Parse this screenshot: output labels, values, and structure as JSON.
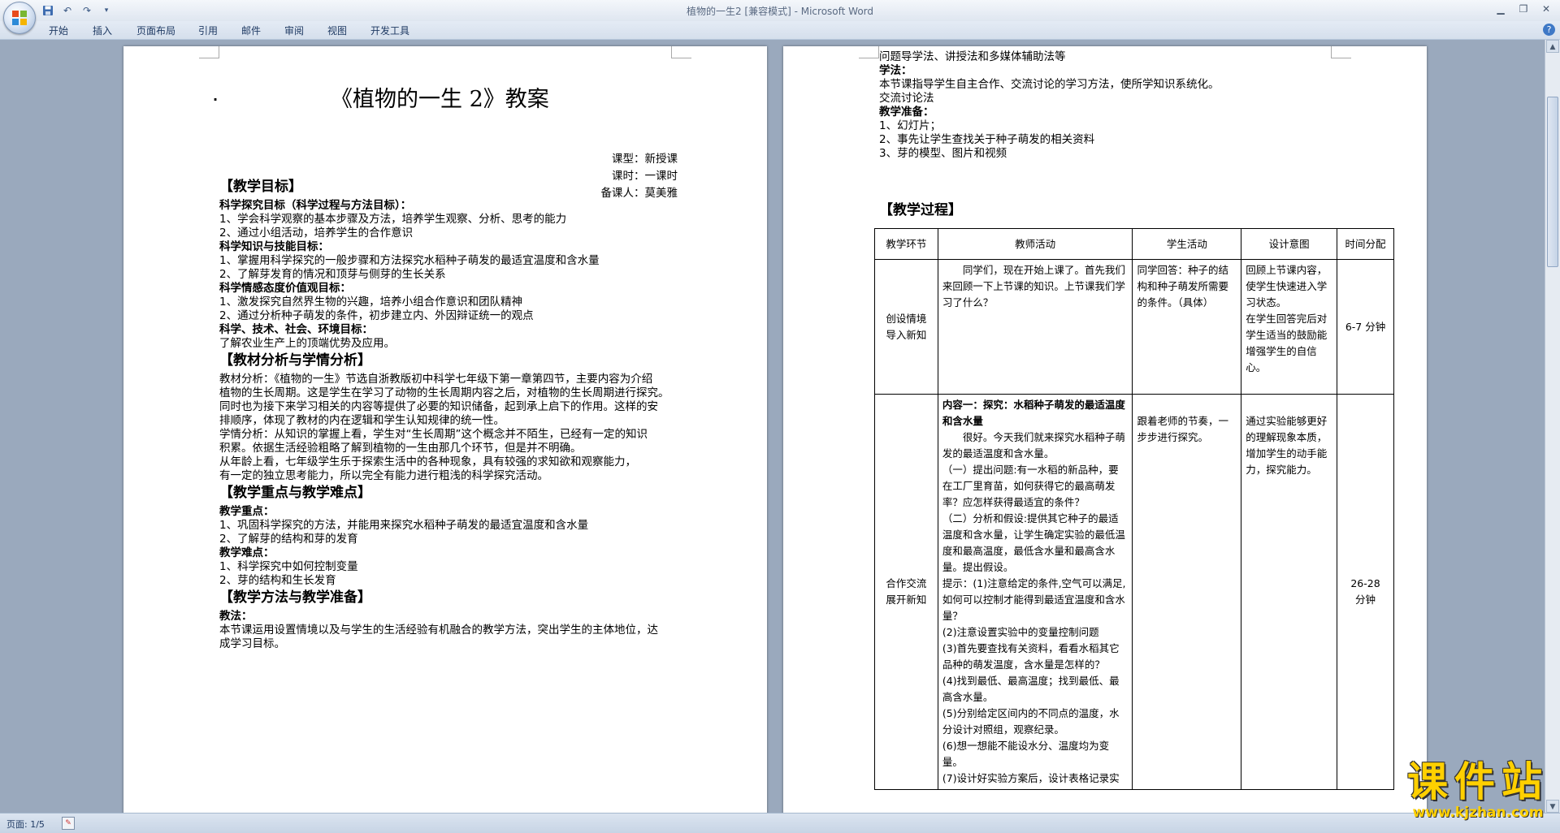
{
  "window": {
    "title": "植物的一生2 [兼容模式] - Microsoft Word",
    "controls": [
      "minimize-icon",
      "restore-icon",
      "close-icon"
    ]
  },
  "ribbon": {
    "tabs": [
      "开始",
      "插入",
      "页面布局",
      "引用",
      "邮件",
      "审阅",
      "视图",
      "开发工具"
    ],
    "help": "?"
  },
  "status": {
    "page": "页面: 1/5"
  },
  "watermark": {
    "text": "课件站",
    "url": "www.kjzhan.com"
  },
  "page1": {
    "dot": "·",
    "title": "《植物的一生 2》教案",
    "meta": [
      "课型：新授课",
      "课时：一课时",
      "备课人：莫美雅"
    ],
    "lines": [
      {
        "cls": "h",
        "text": "【教学目标】"
      },
      {
        "cls": "b",
        "text": "科学探究目标（科学过程与方法目标）："
      },
      {
        "cls": "",
        "text": "1、学会科学观察的基本步骤及方法，培养学生观察、分析、思考的能力"
      },
      {
        "cls": "",
        "text": "2、通过小组活动，培养学生的合作意识"
      },
      {
        "cls": "b",
        "text": "科学知识与技能目标："
      },
      {
        "cls": "",
        "text": "1、掌握用科学探究的一般步骤和方法探究水稻种子萌发的最适宜温度和含水量"
      },
      {
        "cls": "",
        "text": "2、了解芽发育的情况和顶芽与侧芽的生长关系"
      },
      {
        "cls": "b",
        "text": "科学情感态度价值观目标："
      },
      {
        "cls": "",
        "text": "1、激发探究自然界生物的兴趣，培养小组合作意识和团队精神"
      },
      {
        "cls": "",
        "text": "2、通过分析种子萌发的条件，初步建立内、外因辩证统一的观点"
      },
      {
        "cls": "b",
        "text": "科学、技术、社会、环境目标："
      },
      {
        "cls": "",
        "text": "了解农业生产上的顶端优势及应用。"
      },
      {
        "cls": "h",
        "text": "【教材分析与学情分析】"
      },
      {
        "cls": "",
        "text": "教材分析：《植物的一生》节选自浙教版初中科学七年级下第一章第四节，主要内容为介绍"
      },
      {
        "cls": "",
        "text": "植物的生长周期。这是学生在学习了动物的生长周期内容之后，对植物的生长周期进行探究。"
      },
      {
        "cls": "",
        "text": "同时也为接下来学习相关的内容等提供了必要的知识储备，起到承上启下的作用。这样的安"
      },
      {
        "cls": "",
        "text": "排顺序，体现了教材的内在逻辑和学生认知规律的统一性。"
      },
      {
        "cls": "",
        "text": "学情分析：从知识的掌握上看，学生对“生长周期”这个概念并不陌生，已经有一定的知识"
      },
      {
        "cls": "",
        "text": "积累。依据生活经验粗略了解到植物的一生由那几个环节，但是并不明确。"
      },
      {
        "cls": "",
        "text": "        从年龄上看，七年级学生乐于探索生活中的各种现象，具有较强的求知欲和观察能力，"
      },
      {
        "cls": "",
        "text": "有一定的独立思考能力，所以完全有能力进行粗浅的科学探究活动。"
      },
      {
        "cls": "h",
        "text": "【教学重点与教学难点】"
      },
      {
        "cls": "b",
        "text": "教学重点："
      },
      {
        "cls": "",
        "text": "1、巩固科学探究的方法，并能用来探究水稻种子萌发的最适宜温度和含水量"
      },
      {
        "cls": "",
        "text": "2、了解芽的结构和芽的发育"
      },
      {
        "cls": "b",
        "text": "教学难点："
      },
      {
        "cls": "",
        "text": "1、科学探究中如何控制变量"
      },
      {
        "cls": "",
        "text": " 2、芽的结构和生长发育"
      },
      {
        "cls": "h",
        "text": "【教学方法与教学准备】"
      },
      {
        "cls": "b",
        "text": "教法："
      },
      {
        "cls": "",
        "text": "本节课运用设置情境以及与学生的生活经验有机融合的教学方法，突出学生的主体地位，达"
      },
      {
        "cls": "",
        "text": "成学习目标。"
      }
    ]
  },
  "page2": {
    "lines": [
      {
        "cls": "",
        "text": "问题导学法、讲授法和多媒体辅助法等"
      },
      {
        "cls": "b",
        "text": "学法："
      },
      {
        "cls": "",
        "text": "本节课指导学生自主合作、交流讨论的学习方法，使所学知识系统化。"
      },
      {
        "cls": "",
        "text": "交流讨论法"
      },
      {
        "cls": "b",
        "text": "教学准备："
      },
      {
        "cls": "",
        "text": "1、幻灯片；"
      },
      {
        "cls": "",
        "text": "2、事先让学生查找关于种子萌发的相关资料"
      },
      {
        "cls": "",
        "text": "3、芽的模型、图片和视频"
      }
    ],
    "process_heading": "【教学过程】",
    "table": {
      "headers": [
        "教学环节",
        "教师活动",
        "学生活动",
        "设计意图",
        "时间分配"
      ],
      "rows": [
        {
          "stage": [
            "创设情境",
            "导入新知"
          ],
          "teacher": [
            "同学们，现在开始上课了。首先我们来回顾一下上节课的知识。上节课我们学习了什么？"
          ],
          "student": [
            "同学回答：种子的结构和种子萌发所需要的条件。（具体）"
          ],
          "intent": [
            "回顾上节课内容，使学生快速进入学习状态。",
            "在学生回答完后对学生适当的鼓励能增强学生的自信心。"
          ],
          "time": [
            "6-7 分钟"
          ]
        },
        {
          "stage": [
            "合作交流",
            "展开新知"
          ],
          "teacher_title": "内容一：探究：水稻种子萌发的最适温度和含水量",
          "teacher": [
            "很好。今天我们就来探究水稻种子萌发的最适温度和含水量。",
            "（一）提出问题:有一水稻的新品种，要在工厂里育苗，如何获得它的最高萌发率？应怎样获得最适宜的条件？",
            "（二）分析和假设:提供其它种子的最适温度和含水量，让学生确定实验的最低温度和最高温度，最低含水量和最高含水量。提出假设。",
            "提示：(1)注意给定的条件,空气可以满足,如何可以控制才能得到最适宜温度和含水量？",
            "(2)注意设置实验中的变量控制问题",
            "(3)首先要查找有关资料，看看水稻其它品种的萌发温度，含水量是怎样的？",
            "(4)找到最低、最高温度；找到最低、最高含水量。",
            "(5)分别给定区间内的不同点的温度，水分设计对照组，观察纪录。",
            "(6)想一想能不能设水分、温度均为变量。",
            "(7)设计好实验方案后，设计表格记录实"
          ],
          "student": [
            "跟着老师的节奏，一步步进行探究。"
          ],
          "intent": [
            "通过实验能够更好的理解现象本质，增加学生的动手能力，探究能力。"
          ],
          "time": [
            "26-28",
            "分钟"
          ]
        }
      ]
    }
  }
}
